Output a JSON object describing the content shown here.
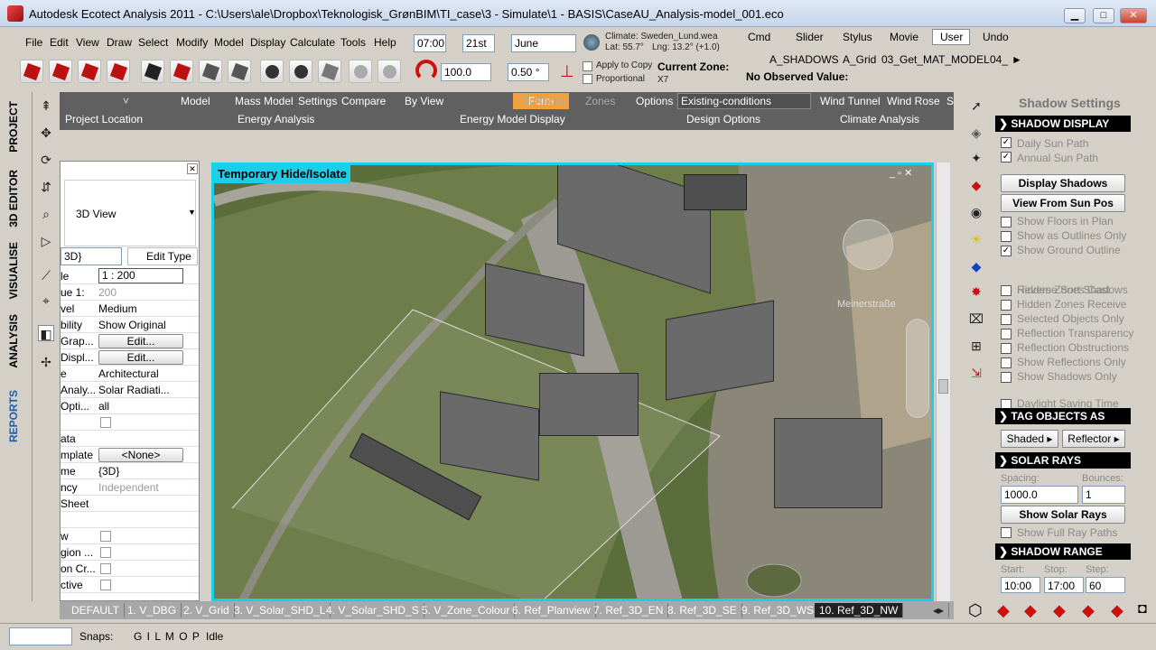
{
  "window": {
    "title": "Autodesk Ecotect Analysis 2011 - C:\\Users\\ale\\Dropbox\\Teknologisk_GrønBIM\\TI_case\\3 - Simulate\\1 - BASIS\\CaseAU_Analysis-model_001.eco",
    "minimize": "▁",
    "maximize": "□",
    "close": "✕"
  },
  "menu": [
    "File",
    "Edit",
    "View",
    "Draw",
    "Select",
    "Modify",
    "Model",
    "Display",
    "Calculate",
    "Tools",
    "Help"
  ],
  "time": {
    "time": "07:00",
    "day": "21st",
    "month": "June",
    "climate": "Climate: Sweden_Lund.wea",
    "lat": "Lat: 55.7°",
    "lng": "Lng: 13.2° (+1.0)"
  },
  "toolbar2": {
    "value1": "100.0",
    "value2": "0.50 °",
    "apply_copy": "Apply to Copy",
    "proportional": "Proportional",
    "current_zone_label": "Current Zone:",
    "current_zone_value": "X7",
    "no_observed": "No Observed Value:"
  },
  "right_top_tabs": [
    "Cmd",
    "Slider",
    "Stylus",
    "Movie",
    "User",
    "Undo"
  ],
  "right_top_items": [
    "A_SHADOWS",
    "A_Grid",
    "03_Get_MAT_MODEL",
    "04_"
  ],
  "left_tabs": [
    "PROJECT",
    "3D EDITOR",
    "VISUALISE",
    "ANALYSIS",
    "REPORTS"
  ],
  "ribbon": {
    "top": [
      "Model",
      "Mass Model",
      "Settings",
      "Compare",
      "By View",
      "Form",
      "Surfaces",
      "Zones",
      "Options"
    ],
    "existing": "Existing-conditions",
    "right": [
      "Wind Tunnel",
      "Wind Rose",
      "S"
    ],
    "bottom": [
      "Project Location",
      "Energy Analysis",
      "Energy Model Display",
      "Design Options",
      "Climate Analysis"
    ]
  },
  "props": {
    "view_type": "3D View",
    "view_select": "3D}",
    "edit_type": "Edit Type",
    "rows": [
      {
        "k": "le",
        "v": "1 : 200"
      },
      {
        "k": "ue 1:",
        "v": "200"
      },
      {
        "k": "vel",
        "v": "Medium"
      },
      {
        "k": "bility",
        "v": "Show Original"
      },
      {
        "k": "Grap...",
        "v": "Edit..."
      },
      {
        "k": "Displ...",
        "v": "Edit..."
      },
      {
        "k": "e",
        "v": "Architectural"
      },
      {
        "k": "Analy...",
        "v": "Solar Radiati..."
      },
      {
        "k": "Opti...",
        "v": "all"
      },
      {
        "k": "",
        "v": ""
      },
      {
        "k": "ata",
        "v": ""
      },
      {
        "k": "mplate",
        "v": "<None>"
      },
      {
        "k": "me",
        "v": "{3D}"
      },
      {
        "k": "ncy",
        "v": "Independent"
      },
      {
        "k": "Sheet",
        "v": ""
      },
      {
        "k": "",
        "v": ""
      },
      {
        "k": "w",
        "v": ""
      },
      {
        "k": "gion ...",
        "v": ""
      },
      {
        "k": "on Cr...",
        "v": ""
      },
      {
        "k": "ctive",
        "v": ""
      }
    ]
  },
  "viewport": {
    "title": "Temporary Hide/Isolate",
    "street": "Meinerstraße"
  },
  "view_tabs": [
    "DEFAULT",
    "1. V_DBG",
    "2. V_Grid",
    "3. V_Solar_SHD_L",
    "4. V_Solar_SHD_S",
    "5. V_Zone_Colour",
    "6. Ref_Planview",
    "7. Ref_3D_EN",
    "8. Ref_3D_SE",
    "9. Ref_3D_WS",
    "10. Ref_3D_NW"
  ],
  "status": {
    "snaps_label": "Snaps:",
    "snaps": "G I L M O P",
    "state": "Idle"
  },
  "shadow_settings": {
    "title": "Shadow Settings",
    "display_header": "SHADOW DISPLAY",
    "daily_sun_path": "Daily Sun Path",
    "annual_sun_path": "Annual Sun Path",
    "display_shadows": "Display Shadows",
    "view_from_sun": "View From Sun Pos",
    "options1": [
      {
        "label": "Show Floors in Plan",
        "checked": false
      },
      {
        "label": "Show as Outlines Only",
        "checked": false
      },
      {
        "label": "Show Ground Outline",
        "checked": true
      },
      {
        "label": "Reverse Sort Shadows",
        "checked": false
      }
    ],
    "options2": [
      {
        "label": "Hidden Zones Cast",
        "checked": false
      },
      {
        "label": "Hidden Zones Receive",
        "checked": false
      },
      {
        "label": "Selected Objects Only",
        "checked": false
      },
      {
        "label": "Reflection Transparency",
        "checked": false
      },
      {
        "label": "Reflection Obstructions",
        "checked": false
      },
      {
        "label": "Show Reflections Only",
        "checked": false
      },
      {
        "label": "Show Shadows Only",
        "checked": false
      },
      {
        "label": "Daylight Saving Time",
        "checked": false
      }
    ],
    "tag_header": "TAG OBJECTS AS",
    "shaded": "Shaded",
    "reflector": "Reflector",
    "rays_header": "SOLAR RAYS",
    "spacing_label": "Spacing:",
    "spacing": "1000.0",
    "bounces_label": "Bounces:",
    "bounces": "1",
    "show_solar_rays": "Show Solar Rays",
    "show_full_ray": "Show Full Ray Paths",
    "range_header": "SHADOW RANGE",
    "start_label": "Start:",
    "start": "10:00",
    "stop_label": "Stop:",
    "stop": "17:00",
    "step_label": "Step:",
    "step": "60"
  }
}
